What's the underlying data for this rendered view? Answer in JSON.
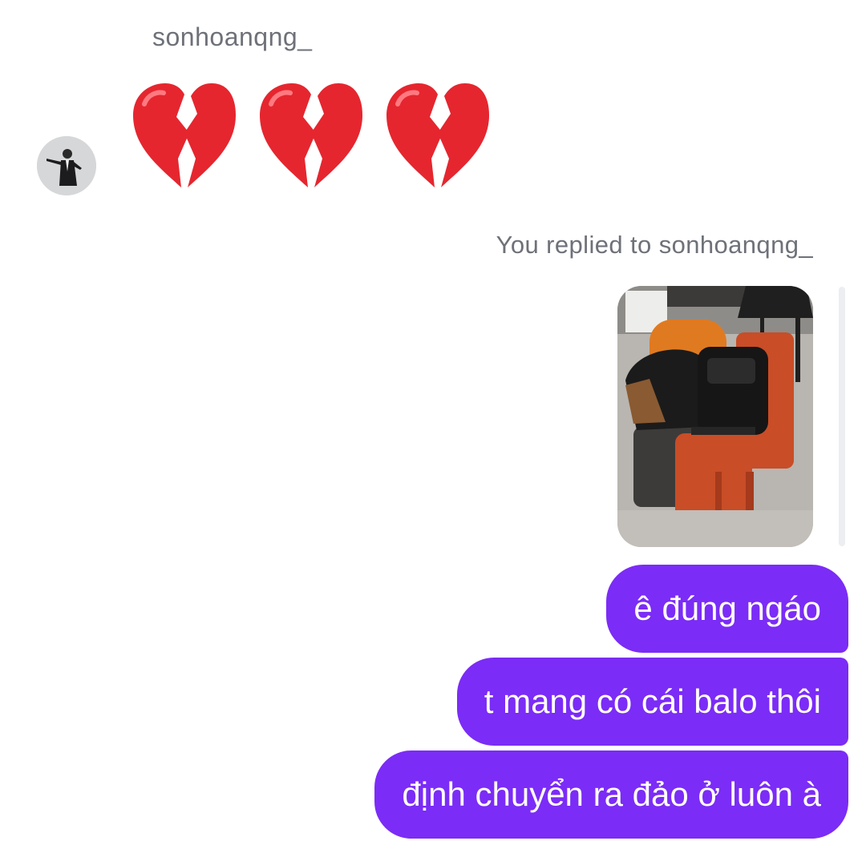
{
  "thread": {
    "sender_name": "sonhoanqng_",
    "sender_message": {
      "emojis": [
        "💔",
        "💔",
        "💔"
      ]
    },
    "replied_label": "You replied to sonhoanqng_",
    "my_messages": [
      "ê đúng ngáo",
      "t mang có cái balo thôi",
      "định chuyển ra đảo ở luôn à"
    ]
  },
  "colors": {
    "bubble": "#7b2cf6",
    "meta_text": "#6e7178",
    "heart_red": "#e5262f"
  },
  "icons": {
    "heart": "broken-heart-icon"
  }
}
